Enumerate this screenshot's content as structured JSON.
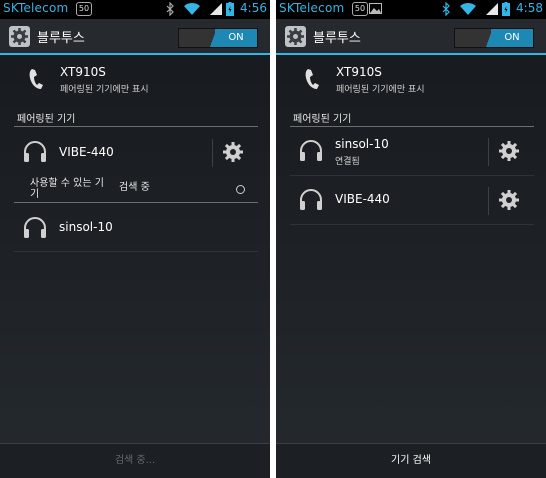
{
  "colors": {
    "accent": "#33b5e5",
    "toggle_on": "#1e88b5",
    "background": "#1e2226"
  },
  "left": {
    "statusbar": {
      "carrier": "SKTelecom",
      "badge": "50",
      "time": "4:56",
      "icons": [
        "bluetooth-icon",
        "wifi-icon",
        "signal-icon",
        "battery-icon"
      ]
    },
    "actionbar": {
      "title": "블루투스",
      "toggle_label": "ON"
    },
    "device": {
      "name": "XT910S",
      "visibility": "페어링된 기기에만 표시"
    },
    "paired_section": "페어링된 기기",
    "paired": [
      {
        "name": "VIBE-440"
      }
    ],
    "available_section": "사용할 수 있는 기기",
    "searching_status": "검색 중",
    "available": [
      {
        "name": "sinsol-10"
      }
    ],
    "bottom_button": "검색 중..."
  },
  "right": {
    "statusbar": {
      "carrier": "SKTelecom",
      "badge": "50",
      "time": "4:58",
      "icons": [
        "image-icon",
        "bluetooth-icon",
        "wifi-icon",
        "signal-icon",
        "battery-icon"
      ]
    },
    "actionbar": {
      "title": "블루투스",
      "toggle_label": "ON"
    },
    "device": {
      "name": "XT910S",
      "visibility": "페어링된 기기에만 표시"
    },
    "paired_section": "페어링된 기기",
    "paired": [
      {
        "name": "sinsol-10",
        "status": "연결됨"
      },
      {
        "name": "VIBE-440"
      }
    ],
    "bottom_button": "기기 검색"
  }
}
